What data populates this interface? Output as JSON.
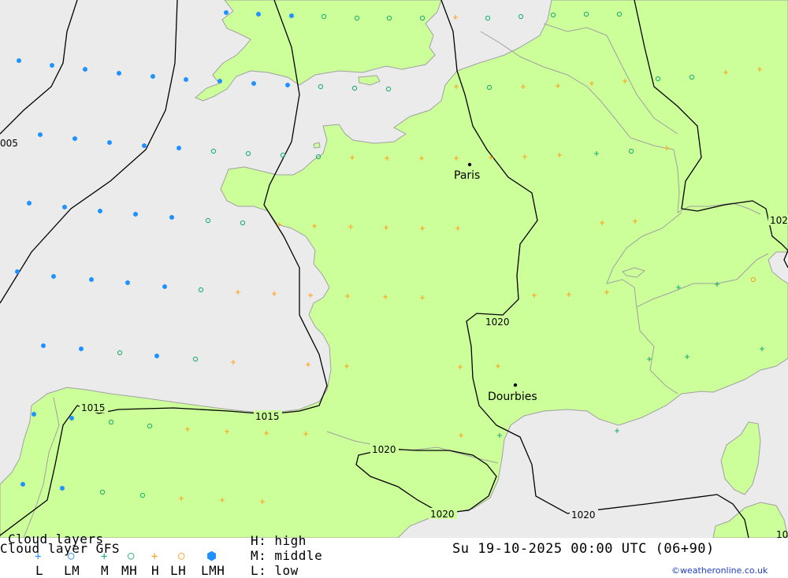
{
  "colors": {
    "sea": "#ebebeb",
    "land": "#ccff99",
    "border": "#a0a0a0",
    "isobar": "#000000",
    "low": "#1e90ff",
    "middle": "#20b070",
    "high": "#ffa020",
    "lmh": "#1e90ff"
  },
  "title": "Cloud layers",
  "subtitle": "Cloud layer  GFS",
  "levels": {
    "high": "H: high",
    "middle": "M: middle",
    "low": "L: low"
  },
  "legend_keys": [
    "L",
    "LM",
    "M",
    "MH",
    "H",
    "LH",
    "LMH"
  ],
  "datetime": "Su 19-10-2025 00:00 UTC (06+90)",
  "credit": "©weatheronline.co.uk",
  "cities": [
    {
      "name": "Paris",
      "icon": "city-dot-icon"
    },
    {
      "name": "Dourbies",
      "icon": "city-dot-icon"
    }
  ],
  "isobar_labels": [
    "005",
    "1015",
    "1015",
    "1020",
    "1020",
    "1020",
    "1020",
    "102",
    "10"
  ],
  "symbol_types": {
    "low": "plus-cross-icon",
    "lm": "circle-icon",
    "middle": "plus-cross-icon",
    "mh": "circle-icon",
    "high": "plus-cross-icon",
    "lh": "circle-icon",
    "lmh": "filled-hexagon-icon"
  }
}
